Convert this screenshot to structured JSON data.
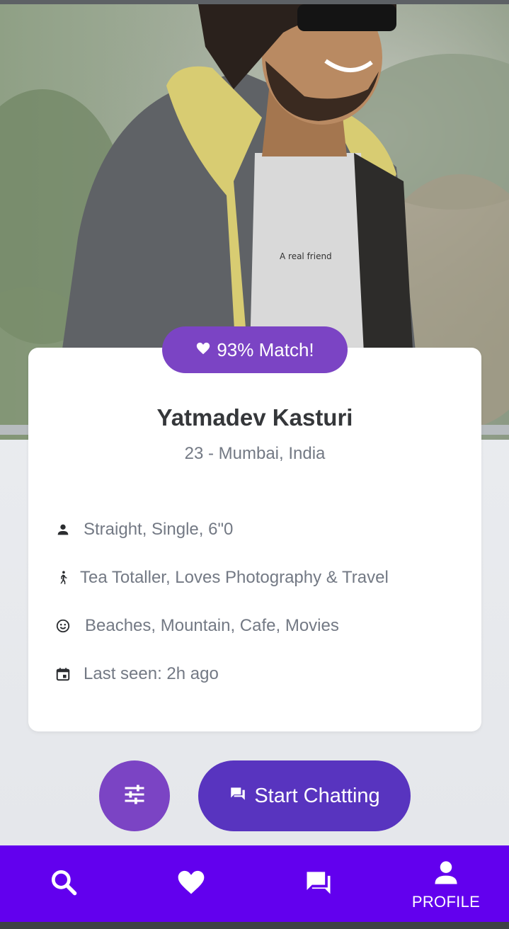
{
  "profile": {
    "match_label": "93% Match!",
    "name": "Yatmadev Kasturi",
    "subtitle": "23 - Mumbai, India",
    "photo_alt": "profile-photo",
    "details": [
      {
        "icon": "person-icon",
        "text": "Straight, Single, 6\"0"
      },
      {
        "icon": "walking-icon",
        "text": "Tea Totaller, Loves Photography & Travel"
      },
      {
        "icon": "smiley-icon",
        "text": "Beaches, Mountain, Cafe, Movies"
      },
      {
        "icon": "calendar-icon",
        "text": "Last seen: 2h ago"
      }
    ]
  },
  "actions": {
    "filter_icon": "tune-icon",
    "chat_label": "Start Chatting",
    "chat_icon": "chat-bubbles-icon"
  },
  "nav": {
    "items": [
      {
        "icon": "search-icon",
        "label": ""
      },
      {
        "icon": "heart-icon",
        "label": ""
      },
      {
        "icon": "forum-icon",
        "label": ""
      },
      {
        "icon": "person-icon",
        "label": "PROFILE"
      }
    ],
    "active_index": 3
  },
  "colors": {
    "accent_purple": "#7b44c4",
    "chat_button": "#5834bf",
    "nav_bar": "#6200ee",
    "text_dark": "#35373a",
    "text_muted": "#737984"
  }
}
